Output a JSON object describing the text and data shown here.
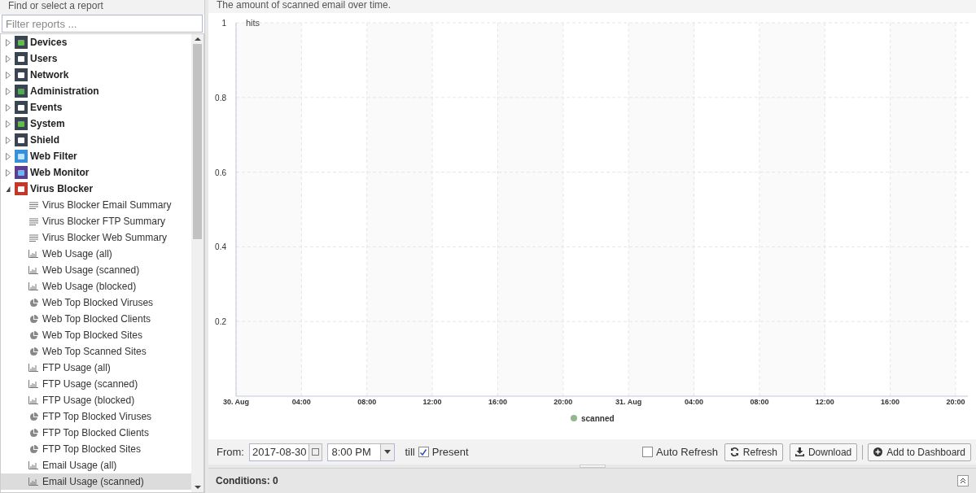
{
  "sidebar": {
    "title": "Find or select a report",
    "filter": {
      "placeholder": "Filter reports ..."
    },
    "tree": [
      {
        "label": "Devices",
        "expanded": false
      },
      {
        "label": "Users",
        "expanded": false
      },
      {
        "label": "Network",
        "expanded": false
      },
      {
        "label": "Administration",
        "expanded": false
      },
      {
        "label": "Events",
        "expanded": false
      },
      {
        "label": "System",
        "expanded": false
      },
      {
        "label": "Shield",
        "expanded": false
      },
      {
        "label": "Web Filter",
        "expanded": false
      },
      {
        "label": "Web Monitor",
        "expanded": false
      },
      {
        "label": "Virus Blocker",
        "expanded": true,
        "children": [
          {
            "label": "Virus Blocker Email Summary",
            "kind": "summary",
            "selected": false
          },
          {
            "label": "Virus Blocker FTP Summary",
            "kind": "summary",
            "selected": false
          },
          {
            "label": "Virus Blocker Web Summary",
            "kind": "summary",
            "selected": false
          },
          {
            "label": "Web Usage (all)",
            "kind": "bar",
            "selected": false
          },
          {
            "label": "Web Usage (scanned)",
            "kind": "bar",
            "selected": false
          },
          {
            "label": "Web Usage (blocked)",
            "kind": "bar",
            "selected": false
          },
          {
            "label": "Web Top Blocked Viruses",
            "kind": "pie",
            "selected": false
          },
          {
            "label": "Web Top Blocked Clients",
            "kind": "pie",
            "selected": false
          },
          {
            "label": "Web Top Blocked Sites",
            "kind": "pie",
            "selected": false
          },
          {
            "label": "Web Top Scanned Sites",
            "kind": "pie",
            "selected": false
          },
          {
            "label": "FTP Usage (all)",
            "kind": "bar",
            "selected": false
          },
          {
            "label": "FTP Usage (scanned)",
            "kind": "bar",
            "selected": false
          },
          {
            "label": "FTP Usage (blocked)",
            "kind": "bar",
            "selected": false
          },
          {
            "label": "FTP Top Blocked Viruses",
            "kind": "pie",
            "selected": false
          },
          {
            "label": "FTP Top Blocked Clients",
            "kind": "pie",
            "selected": false
          },
          {
            "label": "FTP Top Blocked Sites",
            "kind": "pie",
            "selected": false
          },
          {
            "label": "Email Usage (all)",
            "kind": "bar",
            "selected": false
          },
          {
            "label": "Email Usage (scanned)",
            "kind": "bar",
            "selected": true
          }
        ]
      }
    ]
  },
  "report": {
    "description": "The amount of scanned email over time.",
    "chart_data": {
      "type": "line",
      "ylabel": "hits",
      "categories": [
        "30. Aug",
        "04:00",
        "08:00",
        "12:00",
        "16:00",
        "20:00",
        "31. Aug",
        "04:00",
        "08:00",
        "12:00",
        "16:00",
        "20:00"
      ],
      "series": [
        {
          "name": "scanned",
          "color": "#8fb88f",
          "values": [
            null,
            null,
            null,
            null,
            null,
            null,
            null,
            null,
            null,
            null,
            null,
            null
          ]
        }
      ],
      "ylim": [
        0,
        1
      ],
      "yticks": [
        0.2,
        0.4,
        0.6,
        0.8,
        1
      ],
      "grid": true
    }
  },
  "toolbar": {
    "from_label": "From:",
    "date": "2017-08-30",
    "time": "8:00 PM",
    "till_label": "till",
    "present": {
      "label": "Present",
      "checked": true
    },
    "auto_refresh": {
      "label": "Auto Refresh",
      "checked": false
    },
    "refresh": "Refresh",
    "download": "Download",
    "add_to_dashboard": "Add to Dashboard"
  },
  "conditions": {
    "title": "Conditions: 0"
  }
}
